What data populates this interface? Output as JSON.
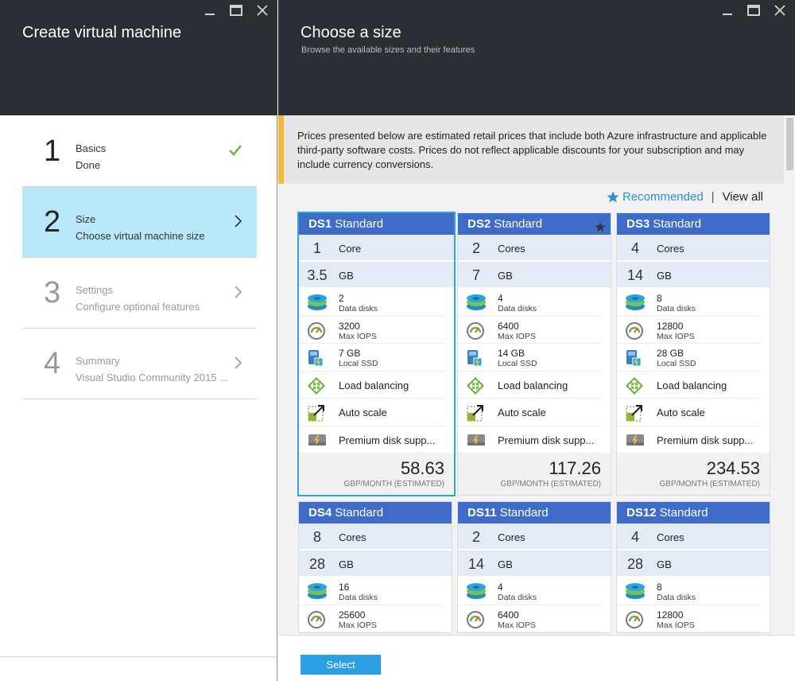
{
  "left_blade": {
    "title": "Create virtual machine",
    "steps": [
      {
        "num": "1",
        "title": "Basics",
        "desc": "Done"
      },
      {
        "num": "2",
        "title": "Size",
        "desc": "Choose virtual machine size"
      },
      {
        "num": "3",
        "title": "Settings",
        "desc": "Configure optional features"
      },
      {
        "num": "4",
        "title": "Summary",
        "desc": "Visual Studio Community 2015 ..."
      }
    ]
  },
  "right_blade": {
    "title": "Choose a size",
    "subtitle": "Browse the available sizes and their features",
    "notice": "Prices presented below are estimated retail prices that include both Azure infrastructure and applicable third-party software costs. Prices do not reflect applicable discounts for your subscription and may include currency conversions.",
    "filter": {
      "recommended": "Recommended",
      "separator": "|",
      "view_all": "View all"
    },
    "select_label": "Select"
  },
  "cards": [
    {
      "code": "DS1",
      "tier": "Standard",
      "cores": "1",
      "cores_label": "Core",
      "ram": "3.5",
      "ram_unit": "GB",
      "disks": "2",
      "disks_label": "Data disks",
      "iops": "3200",
      "iops_label": "Max IOPS",
      "ssd": "7 GB",
      "ssd_label": "Local SSD",
      "lb": "Load balancing",
      "autoscale": "Auto scale",
      "premium": "Premium disk supp...",
      "price": "58.63",
      "price_unit": "GBP/MONTH (ESTIMATED)"
    },
    {
      "code": "DS2",
      "tier": "Standard",
      "cores": "2",
      "cores_label": "Cores",
      "ram": "7",
      "ram_unit": "GB",
      "disks": "4",
      "disks_label": "Data disks",
      "iops": "6400",
      "iops_label": "Max IOPS",
      "ssd": "14 GB",
      "ssd_label": "Local SSD",
      "lb": "Load balancing",
      "autoscale": "Auto scale",
      "premium": "Premium disk supp...",
      "price": "117.26",
      "price_unit": "GBP/MONTH (ESTIMATED)"
    },
    {
      "code": "DS3",
      "tier": "Standard",
      "cores": "4",
      "cores_label": "Cores",
      "ram": "14",
      "ram_unit": "GB",
      "disks": "8",
      "disks_label": "Data disks",
      "iops": "12800",
      "iops_label": "Max IOPS",
      "ssd": "28 GB",
      "ssd_label": "Local SSD",
      "lb": "Load balancing",
      "autoscale": "Auto scale",
      "premium": "Premium disk supp...",
      "price": "234.53",
      "price_unit": "GBP/MONTH (ESTIMATED)"
    },
    {
      "code": "DS4",
      "tier": "Standard",
      "cores": "8",
      "cores_label": "Cores",
      "ram": "28",
      "ram_unit": "GB",
      "disks": "16",
      "disks_label": "Data disks",
      "iops": "25600",
      "iops_label": "Max IOPS"
    },
    {
      "code": "DS11",
      "tier": "Standard",
      "cores": "2",
      "cores_label": "Cores",
      "ram": "14",
      "ram_unit": "GB",
      "disks": "4",
      "disks_label": "Data disks",
      "iops": "6400",
      "iops_label": "Max IOPS"
    },
    {
      "code": "DS12",
      "tier": "Standard",
      "cores": "4",
      "cores_label": "Cores",
      "ram": "28",
      "ram_unit": "GB",
      "disks": "8",
      "disks_label": "Data disks",
      "iops": "12800",
      "iops_label": "Max IOPS"
    }
  ],
  "colors": {
    "header_bg": "#2b2f33",
    "accent": "#3f6bc9",
    "active_step": "#b9e9f8",
    "selected_border": "#2ba6d9",
    "check": "#6cb33f",
    "notice_bar": "#f6b83c"
  }
}
